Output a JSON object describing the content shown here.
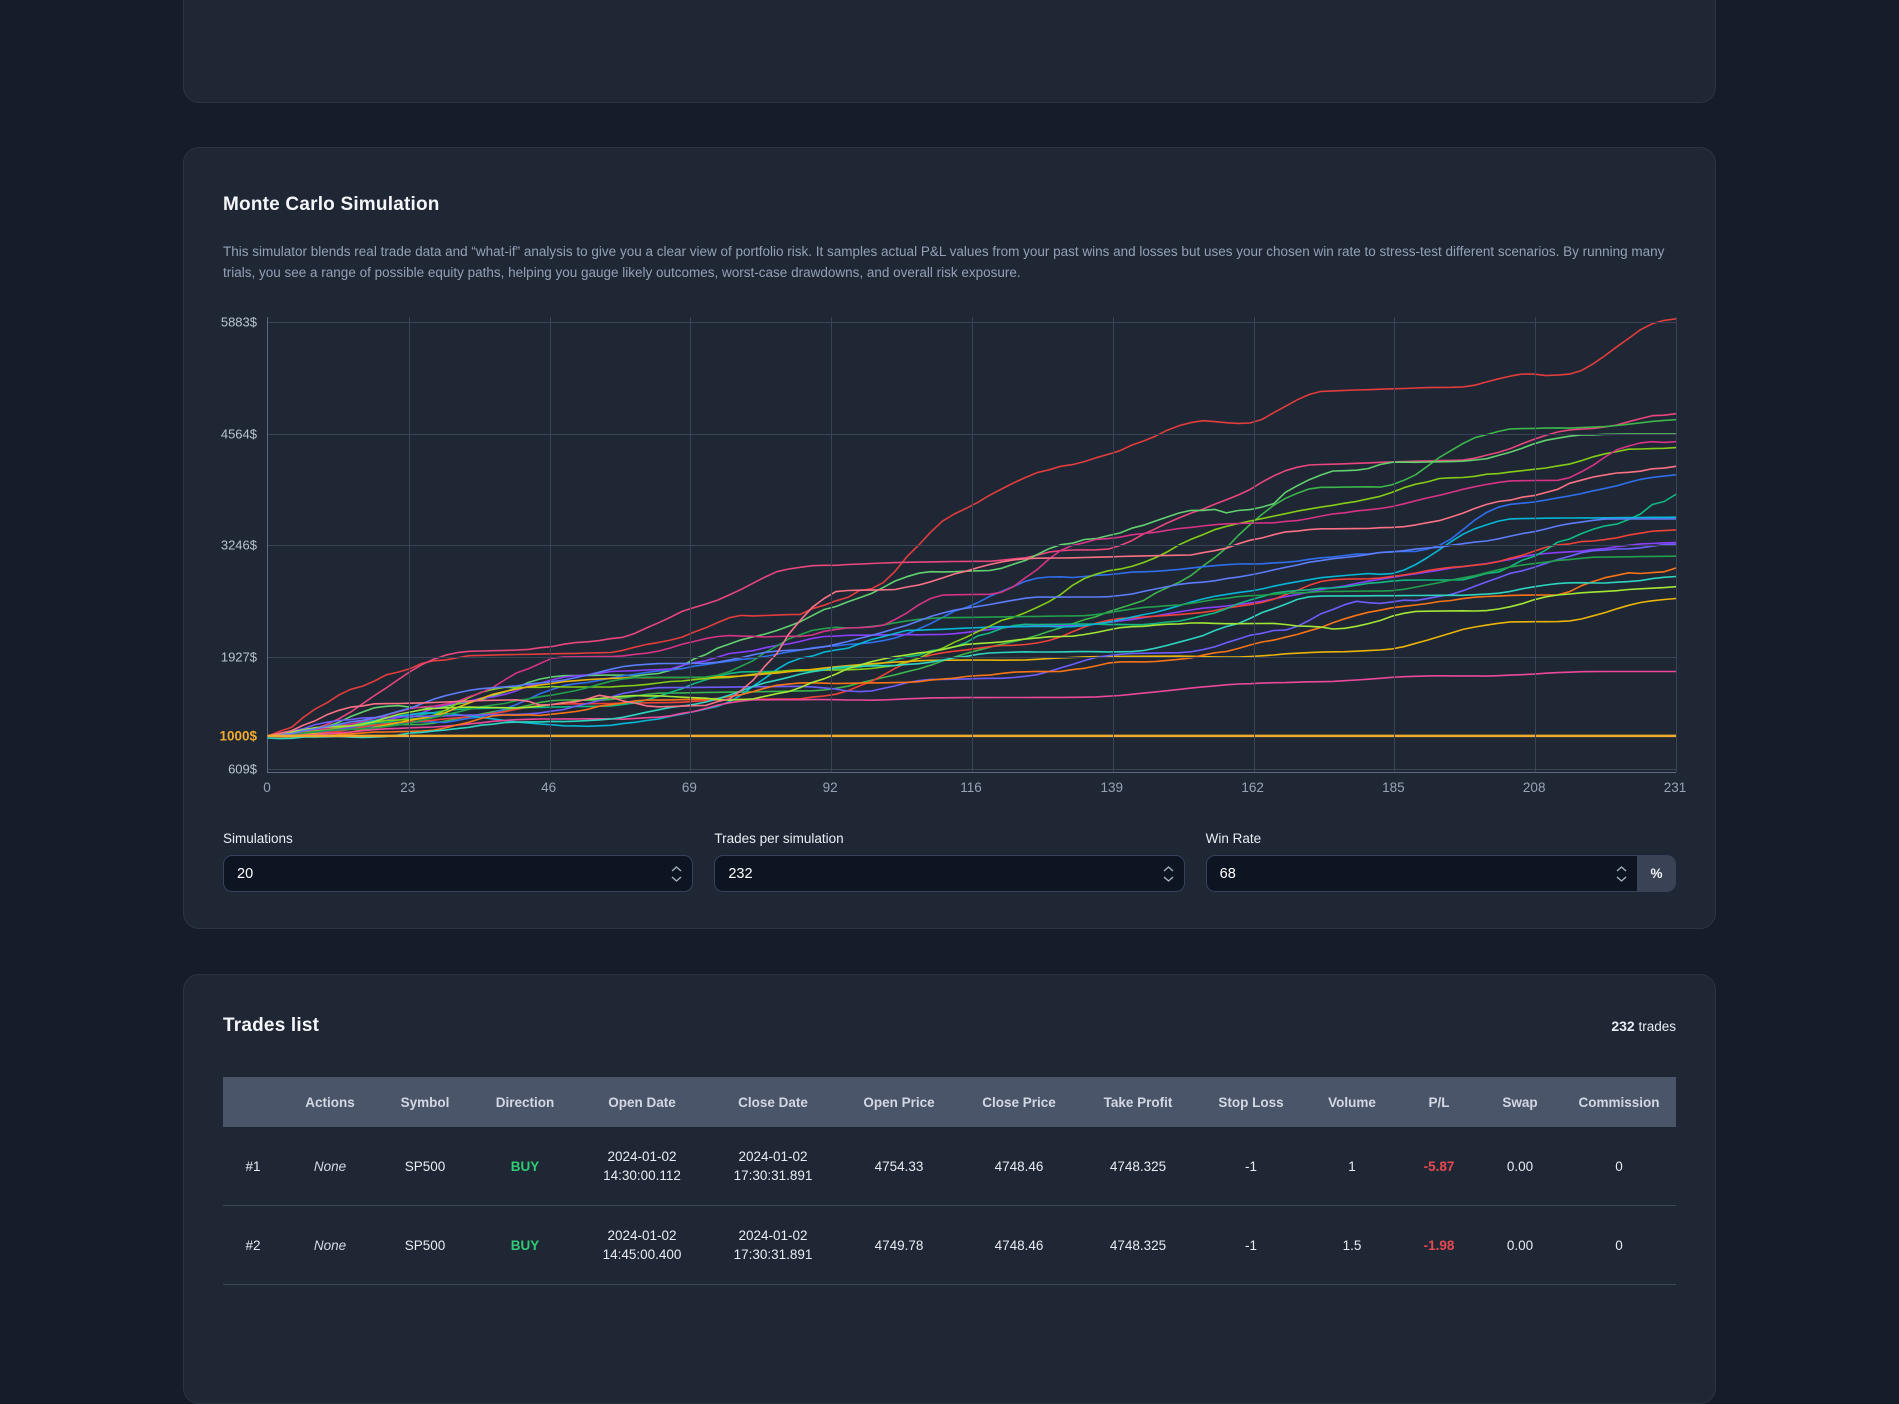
{
  "colors": {
    "buy_green": "#2fca73",
    "loss_red": "#e8484f",
    "baseline_gold": "#f0ab2d",
    "table_header_bg": "#4b5569"
  },
  "monte_carlo": {
    "title": "Monte Carlo Simulation",
    "description": "This simulator blends real trade data and “what-if” analysis to give you a clear view of portfolio risk. It samples actual P&L values from your past wins and losses but uses your chosen win rate to stress-test different scenarios. By running many trials, you see a range of possible equity paths, helping you gauge likely outcomes, worst-case drawdowns, and overall risk exposure.",
    "inputs": {
      "simulations": {
        "label": "Simulations",
        "value": "20"
      },
      "trades_per_simulation": {
        "label": "Trades per simulation",
        "value": "232"
      },
      "win_rate": {
        "label": "Win Rate",
        "value": "68",
        "unit": "%"
      }
    }
  },
  "chart_data": {
    "type": "line",
    "grid": true,
    "legend": "none",
    "x_ticks": [
      "0",
      "23",
      "46",
      "69",
      "92",
      "116",
      "139",
      "162",
      "185",
      "208",
      "231"
    ],
    "x_range": [
      0,
      231
    ],
    "y_ticks": [
      {
        "label": "5883$",
        "value": 5883
      },
      {
        "label": "4564$",
        "value": 4564
      },
      {
        "label": "3246$",
        "value": 3246
      },
      {
        "label": "1927$",
        "value": 1927
      },
      {
        "label": "1000$",
        "value": 1000,
        "baseline": true
      },
      {
        "label": "609$",
        "value": 609
      }
    ],
    "y_domain": [
      574,
      5941
    ],
    "baseline": {
      "label": "1000$",
      "value": 1000,
      "color": "#f0ab2d"
    },
    "n_points": 120,
    "start_value": 1000,
    "series": [
      {
        "color": "#e23c3c",
        "end": 5920,
        "seed": 3
      },
      {
        "color": "#e8467c",
        "end": 4800,
        "seed": 7
      },
      {
        "color": "#3cb54a",
        "end": 4730,
        "seed": 11
      },
      {
        "color": "#63d06f",
        "end": 4560,
        "seed": 5
      },
      {
        "color": "#2f6fed",
        "end": 4080,
        "seed": 21
      },
      {
        "color": "#8a3ffc",
        "end": 3280,
        "seed": 9
      },
      {
        "color": "#ef4136",
        "end": 3430,
        "seed": 33
      },
      {
        "color": "#10b981",
        "end": 3850,
        "seed": 17
      },
      {
        "color": "#06b6d4",
        "end": 3580,
        "seed": 25,
        "dip": 380,
        "dip_at": 0.27
      },
      {
        "color": "#84cc16",
        "end": 4400,
        "seed": 29
      },
      {
        "color": "#eab308",
        "end": 2620,
        "seed": 41
      },
      {
        "color": "#ec4899",
        "end": 1760,
        "seed": 37
      },
      {
        "color": "#6d5dfc",
        "end": 3260,
        "seed": 13
      },
      {
        "color": "#22a04c",
        "end": 3120,
        "seed": 19
      },
      {
        "color": "#f97316",
        "end": 2980,
        "seed": 23
      },
      {
        "color": "#2dd4bf",
        "end": 2880,
        "seed": 31,
        "dip": 260,
        "dip_at": 0.2
      },
      {
        "color": "#d63384",
        "end": 4470,
        "seed": 43
      },
      {
        "color": "#a3e635",
        "end": 2760,
        "seed": 47,
        "dip": 200,
        "dip_at": 0.35
      },
      {
        "color": "#5c7cfa",
        "end": 3560,
        "seed": 53
      },
      {
        "color": "#fb7185",
        "end": 4180,
        "seed": 59
      }
    ]
  },
  "trades": {
    "title": "Trades list",
    "count": "232",
    "count_suffix": " trades",
    "columns": [
      "",
      "Actions",
      "Symbol",
      "Direction",
      "Open Date",
      "Close Date",
      "Open Price",
      "Close Price",
      "Take Profit",
      "Stop Loss",
      "Volume",
      "P/L",
      "Swap",
      "Commission"
    ],
    "rows": [
      {
        "id": "#1",
        "actions": "None",
        "symbol": "SP500",
        "direction": "BUY",
        "open_date": [
          "2024-01-02",
          "14:30:00.112"
        ],
        "close_date": [
          "2024-01-02",
          "17:30:31.891"
        ],
        "open_price": "4754.33",
        "close_price": "4748.46",
        "take_profit": "4748.325",
        "stop_loss": "-1",
        "volume": "1",
        "pl": "-5.87",
        "swap": "0.00",
        "commission": "0"
      },
      {
        "id": "#2",
        "actions": "None",
        "symbol": "SP500",
        "direction": "BUY",
        "open_date": [
          "2024-01-02",
          "14:45:00.400"
        ],
        "close_date": [
          "2024-01-02",
          "17:30:31.891"
        ],
        "open_price": "4749.78",
        "close_price": "4748.46",
        "take_profit": "4748.325",
        "stop_loss": "-1",
        "volume": "1.5",
        "pl": "-1.98",
        "swap": "0.00",
        "commission": "0"
      }
    ]
  }
}
